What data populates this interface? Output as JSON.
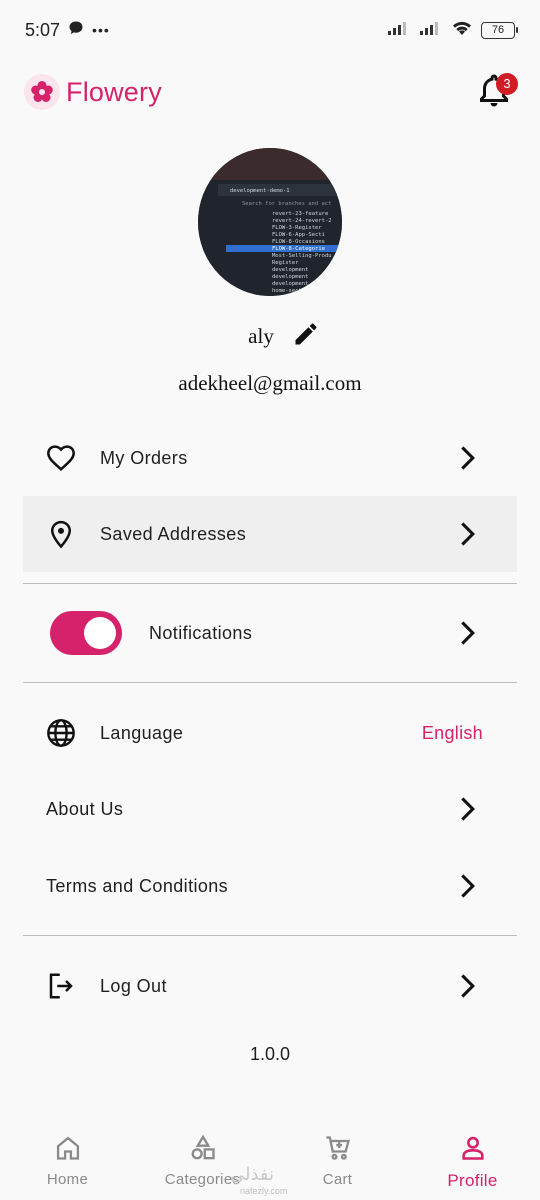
{
  "status_bar": {
    "time": "5:07",
    "dots": "•••",
    "battery": "76"
  },
  "app_bar": {
    "brand_name": "Flowery",
    "notification_count": "3",
    "brand_color": "#d5226b"
  },
  "profile": {
    "name": "aly",
    "email": "adekheel@gmail.com"
  },
  "menu": {
    "my_orders": "My Orders",
    "saved_addresses": "Saved Addresses",
    "notifications": "Notifications",
    "notifications_enabled": true,
    "language": "Language",
    "language_value": "English",
    "about_us": "About Us",
    "terms": "Terms and Conditions",
    "log_out": "Log Out"
  },
  "version": "1.0.0",
  "bottom_nav": {
    "items": [
      {
        "label": "Home",
        "icon": "home-icon",
        "active": false
      },
      {
        "label": "Categories",
        "icon": "categories-icon",
        "active": false
      },
      {
        "label": "Cart",
        "icon": "cart-icon",
        "active": false
      },
      {
        "label": "Profile",
        "icon": "profile-icon",
        "active": true
      }
    ]
  },
  "watermark": {
    "text": "نفذلي",
    "sub": "nafezly.com"
  },
  "avatar_screen_text": [
    "development-demo-1",
    "Search for branches and act",
    "revert-23-feature",
    "revert-24-revert-2",
    "FLOW-3-Register",
    "FLOW-6-App-Secti",
    "FLOW-8-Occasions",
    "FLOW-8-Categorie",
    "Most-Selling-Produ",
    "Register",
    "development",
    "development",
    "development",
    "home-sect"
  ]
}
